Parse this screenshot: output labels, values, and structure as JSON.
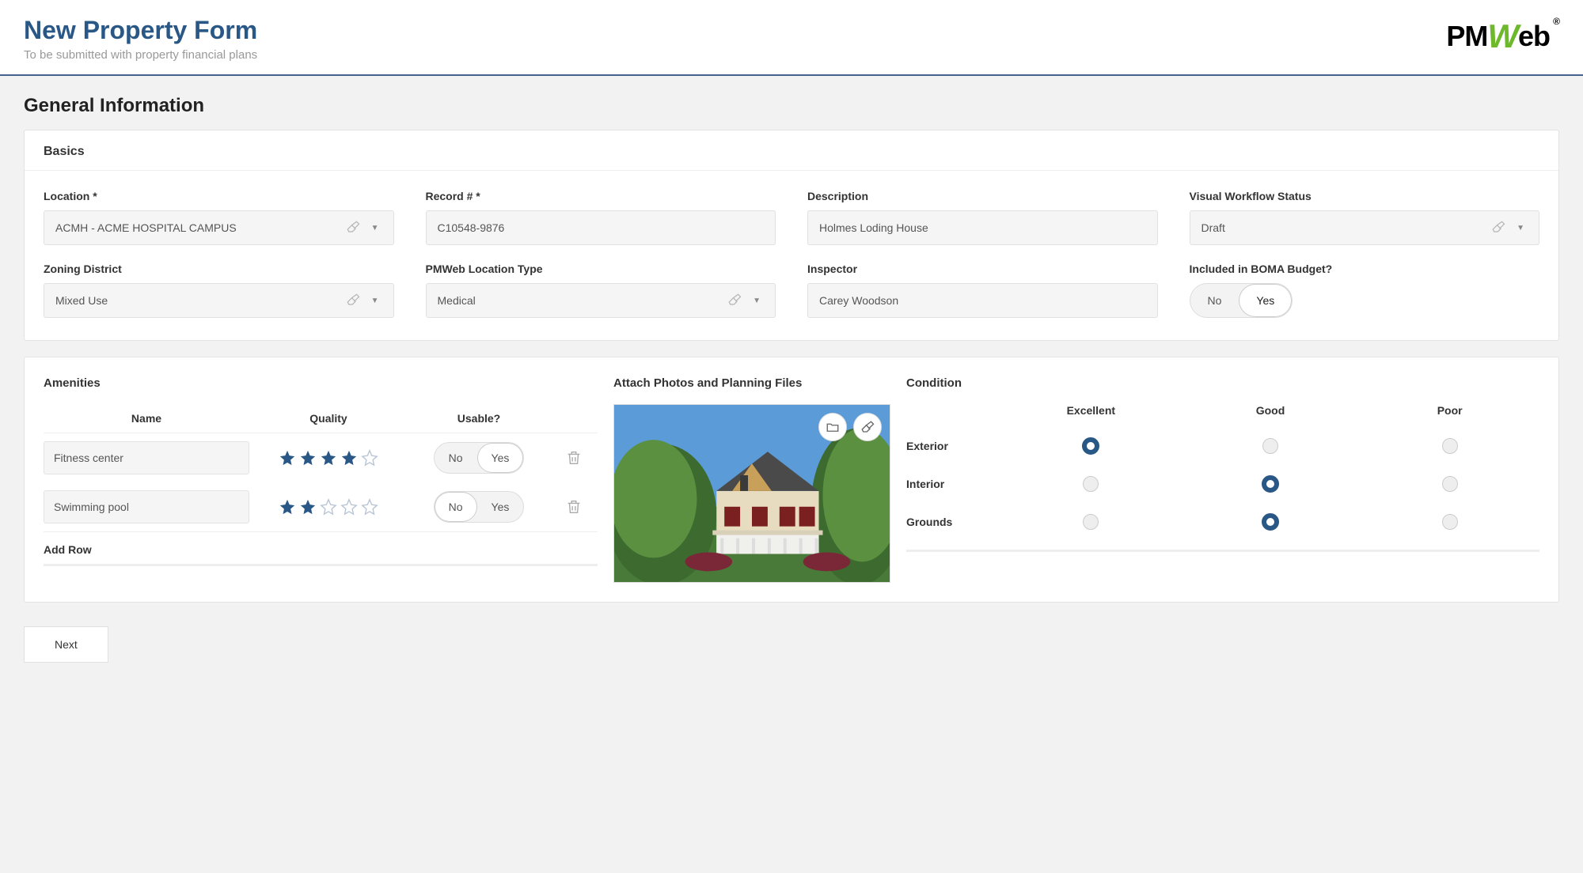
{
  "header": {
    "title": "New Property Form",
    "subtitle": "To be submitted with property financial plans",
    "logo_text_pm": "PM",
    "logo_text_w": "W",
    "logo_text_eb": "eb",
    "logo_reg": "®"
  },
  "section_title": "General Information",
  "basics": {
    "heading": "Basics",
    "location_label": "Location *",
    "location_value": "ACMH - ACME HOSPITAL CAMPUS",
    "record_label": "Record # *",
    "record_value": "C10548-9876",
    "description_label": "Description",
    "description_value": "Holmes Loding House",
    "workflow_label": "Visual Workflow Status",
    "workflow_value": "Draft",
    "zoning_label": "Zoning District",
    "zoning_value": "Mixed Use",
    "loctype_label": "PMWeb Location Type",
    "loctype_value": "Medical",
    "inspector_label": "Inspector",
    "inspector_value": "Carey Woodson",
    "boma_label": "Included in BOMA Budget?",
    "boma_no": "No",
    "boma_yes": "Yes",
    "boma_selected": "Yes"
  },
  "amenities": {
    "heading": "Amenities",
    "col_name": "Name",
    "col_quality": "Quality",
    "col_usable": "Usable?",
    "rows": [
      {
        "name": "Fitness center",
        "stars": 4,
        "usable": "Yes"
      },
      {
        "name": "Swimming pool",
        "stars": 2,
        "usable": "No"
      }
    ],
    "add_row": "Add Row",
    "toggle_no": "No",
    "toggle_yes": "Yes"
  },
  "attach": {
    "heading": "Attach Photos and Planning Files"
  },
  "condition": {
    "heading": "Condition",
    "cols": [
      "Excellent",
      "Good",
      "Poor"
    ],
    "rows": [
      {
        "label": "Exterior",
        "selected": 0
      },
      {
        "label": "Interior",
        "selected": 1
      },
      {
        "label": "Grounds",
        "selected": 1
      }
    ]
  },
  "next_label": "Next"
}
